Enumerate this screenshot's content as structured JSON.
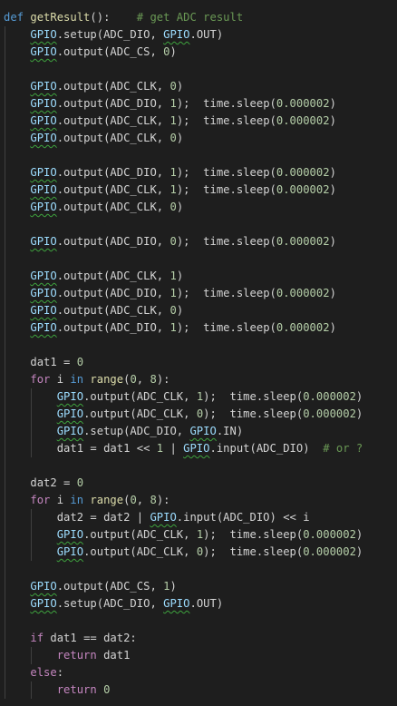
{
  "editor": {
    "indent_spaces": 4,
    "lines": [
      {
        "indent": 0,
        "tokens": [
          [
            "kw",
            "def"
          ],
          [
            "t",
            " "
          ],
          [
            "fn",
            "getResult"
          ],
          [
            "t",
            "():"
          ],
          [
            "t",
            "    "
          ],
          [
            "cm",
            "# get ADC result"
          ]
        ]
      },
      {
        "indent": 1,
        "tokens": [
          [
            "sq",
            "GPIO"
          ],
          [
            "t",
            ".setup(ADC_DIO, "
          ],
          [
            "sq",
            "GPIO"
          ],
          [
            "t",
            ".OUT)"
          ]
        ]
      },
      {
        "indent": 1,
        "tokens": [
          [
            "sq",
            "GPIO"
          ],
          [
            "t",
            ".output(ADC_CS, "
          ],
          [
            "num",
            "0"
          ],
          [
            "t",
            ")"
          ]
        ]
      },
      {
        "indent": 1,
        "tokens": []
      },
      {
        "indent": 1,
        "tokens": [
          [
            "sq",
            "GPIO"
          ],
          [
            "t",
            ".output(ADC_CLK, "
          ],
          [
            "num",
            "0"
          ],
          [
            "t",
            ")"
          ]
        ]
      },
      {
        "indent": 1,
        "tokens": [
          [
            "sq",
            "GPIO"
          ],
          [
            "t",
            ".output(ADC_DIO, "
          ],
          [
            "num",
            "1"
          ],
          [
            "t",
            ");  time.sleep("
          ],
          [
            "num",
            "0.000002"
          ],
          [
            "t",
            ")"
          ]
        ]
      },
      {
        "indent": 1,
        "tokens": [
          [
            "sq",
            "GPIO"
          ],
          [
            "t",
            ".output(ADC_CLK, "
          ],
          [
            "num",
            "1"
          ],
          [
            "t",
            ");  time.sleep("
          ],
          [
            "num",
            "0.000002"
          ],
          [
            "t",
            ")"
          ]
        ]
      },
      {
        "indent": 1,
        "tokens": [
          [
            "sq",
            "GPIO"
          ],
          [
            "t",
            ".output(ADC_CLK, "
          ],
          [
            "num",
            "0"
          ],
          [
            "t",
            ")"
          ]
        ]
      },
      {
        "indent": 1,
        "tokens": []
      },
      {
        "indent": 1,
        "tokens": [
          [
            "sq",
            "GPIO"
          ],
          [
            "t",
            ".output(ADC_DIO, "
          ],
          [
            "num",
            "1"
          ],
          [
            "t",
            ");  time.sleep("
          ],
          [
            "num",
            "0.000002"
          ],
          [
            "t",
            ")"
          ]
        ]
      },
      {
        "indent": 1,
        "tokens": [
          [
            "sq",
            "GPIO"
          ],
          [
            "t",
            ".output(ADC_CLK, "
          ],
          [
            "num",
            "1"
          ],
          [
            "t",
            ");  time.sleep("
          ],
          [
            "num",
            "0.000002"
          ],
          [
            "t",
            ")"
          ]
        ]
      },
      {
        "indent": 1,
        "tokens": [
          [
            "sq",
            "GPIO"
          ],
          [
            "t",
            ".output(ADC_CLK, "
          ],
          [
            "num",
            "0"
          ],
          [
            "t",
            ")"
          ]
        ]
      },
      {
        "indent": 1,
        "tokens": []
      },
      {
        "indent": 1,
        "tokens": [
          [
            "sq",
            "GPIO"
          ],
          [
            "t",
            ".output(ADC_DIO, "
          ],
          [
            "num",
            "0"
          ],
          [
            "t",
            ");  time.sleep("
          ],
          [
            "num",
            "0.000002"
          ],
          [
            "t",
            ")"
          ]
        ]
      },
      {
        "indent": 1,
        "tokens": []
      },
      {
        "indent": 1,
        "tokens": [
          [
            "sq",
            "GPIO"
          ],
          [
            "t",
            ".output(ADC_CLK, "
          ],
          [
            "num",
            "1"
          ],
          [
            "t",
            ")"
          ]
        ]
      },
      {
        "indent": 1,
        "tokens": [
          [
            "sq",
            "GPIO"
          ],
          [
            "t",
            ".output(ADC_DIO, "
          ],
          [
            "num",
            "1"
          ],
          [
            "t",
            ");  time.sleep("
          ],
          [
            "num",
            "0.000002"
          ],
          [
            "t",
            ")"
          ]
        ]
      },
      {
        "indent": 1,
        "tokens": [
          [
            "sq",
            "GPIO"
          ],
          [
            "t",
            ".output(ADC_CLK, "
          ],
          [
            "num",
            "0"
          ],
          [
            "t",
            ")"
          ]
        ]
      },
      {
        "indent": 1,
        "tokens": [
          [
            "sq",
            "GPIO"
          ],
          [
            "t",
            ".output(ADC_DIO, "
          ],
          [
            "num",
            "1"
          ],
          [
            "t",
            ");  time.sleep("
          ],
          [
            "num",
            "0.000002"
          ],
          [
            "t",
            ")"
          ]
        ]
      },
      {
        "indent": 1,
        "tokens": []
      },
      {
        "indent": 1,
        "tokens": [
          [
            "t",
            "dat1 = "
          ],
          [
            "num",
            "0"
          ]
        ]
      },
      {
        "indent": 1,
        "tokens": [
          [
            "ctl",
            "for"
          ],
          [
            "t",
            " i "
          ],
          [
            "kw",
            "in"
          ],
          [
            "t",
            " "
          ],
          [
            "fn",
            "range"
          ],
          [
            "t",
            "("
          ],
          [
            "num",
            "0"
          ],
          [
            "t",
            ", "
          ],
          [
            "num",
            "8"
          ],
          [
            "t",
            "):"
          ]
        ]
      },
      {
        "indent": 2,
        "tokens": [
          [
            "sq",
            "GPIO"
          ],
          [
            "t",
            ".output(ADC_CLK, "
          ],
          [
            "num",
            "1"
          ],
          [
            "t",
            ");  time.sleep("
          ],
          [
            "num",
            "0.000002"
          ],
          [
            "t",
            ")"
          ]
        ]
      },
      {
        "indent": 2,
        "tokens": [
          [
            "sq",
            "GPIO"
          ],
          [
            "t",
            ".output(ADC_CLK, "
          ],
          [
            "num",
            "0"
          ],
          [
            "t",
            ");  time.sleep("
          ],
          [
            "num",
            "0.000002"
          ],
          [
            "t",
            ")"
          ]
        ]
      },
      {
        "indent": 2,
        "tokens": [
          [
            "sq",
            "GPIO"
          ],
          [
            "t",
            ".setup(ADC_DIO, "
          ],
          [
            "sq",
            "GPIO"
          ],
          [
            "t",
            ".IN)"
          ]
        ]
      },
      {
        "indent": 2,
        "tokens": [
          [
            "t",
            "dat1 = dat1 << "
          ],
          [
            "num",
            "1"
          ],
          [
            "t",
            " | "
          ],
          [
            "sq",
            "GPIO"
          ],
          [
            "t",
            ".input(ADC_DIO)  "
          ],
          [
            "cm",
            "# or ?"
          ]
        ]
      },
      {
        "indent": 1,
        "tokens": []
      },
      {
        "indent": 1,
        "tokens": [
          [
            "t",
            "dat2 = "
          ],
          [
            "num",
            "0"
          ]
        ]
      },
      {
        "indent": 1,
        "tokens": [
          [
            "ctl",
            "for"
          ],
          [
            "t",
            " i "
          ],
          [
            "kw",
            "in"
          ],
          [
            "t",
            " "
          ],
          [
            "fn",
            "range"
          ],
          [
            "t",
            "("
          ],
          [
            "num",
            "0"
          ],
          [
            "t",
            ", "
          ],
          [
            "num",
            "8"
          ],
          [
            "t",
            "):"
          ]
        ]
      },
      {
        "indent": 2,
        "tokens": [
          [
            "t",
            "dat2 = dat2 | "
          ],
          [
            "sq",
            "GPIO"
          ],
          [
            "t",
            ".input(ADC_DIO) << i"
          ]
        ]
      },
      {
        "indent": 2,
        "tokens": [
          [
            "sq",
            "GPIO"
          ],
          [
            "t",
            ".output(ADC_CLK, "
          ],
          [
            "num",
            "1"
          ],
          [
            "t",
            ");  time.sleep("
          ],
          [
            "num",
            "0.000002"
          ],
          [
            "t",
            ")"
          ]
        ]
      },
      {
        "indent": 2,
        "tokens": [
          [
            "sq",
            "GPIO"
          ],
          [
            "t",
            ".output(ADC_CLK, "
          ],
          [
            "num",
            "0"
          ],
          [
            "t",
            ");  time.sleep("
          ],
          [
            "num",
            "0.000002"
          ],
          [
            "t",
            ")"
          ]
        ]
      },
      {
        "indent": 1,
        "tokens": []
      },
      {
        "indent": 1,
        "tokens": [
          [
            "sq",
            "GPIO"
          ],
          [
            "t",
            ".output(ADC_CS, "
          ],
          [
            "num",
            "1"
          ],
          [
            "t",
            ")"
          ]
        ]
      },
      {
        "indent": 1,
        "tokens": [
          [
            "sq",
            "GPIO"
          ],
          [
            "t",
            ".setup(ADC_DIO, "
          ],
          [
            "sq",
            "GPIO"
          ],
          [
            "t",
            ".OUT)"
          ]
        ]
      },
      {
        "indent": 1,
        "tokens": []
      },
      {
        "indent": 1,
        "tokens": [
          [
            "ctl",
            "if"
          ],
          [
            "t",
            " dat1 == dat2:"
          ]
        ]
      },
      {
        "indent": 2,
        "tokens": [
          [
            "ctl",
            "return"
          ],
          [
            "t",
            " dat1"
          ]
        ]
      },
      {
        "indent": 1,
        "tokens": [
          [
            "ctl",
            "else"
          ],
          [
            "t",
            ":"
          ]
        ]
      },
      {
        "indent": 2,
        "tokens": [
          [
            "ctl",
            "return"
          ],
          [
            "t",
            " "
          ],
          [
            "num",
            "0"
          ]
        ]
      }
    ]
  }
}
